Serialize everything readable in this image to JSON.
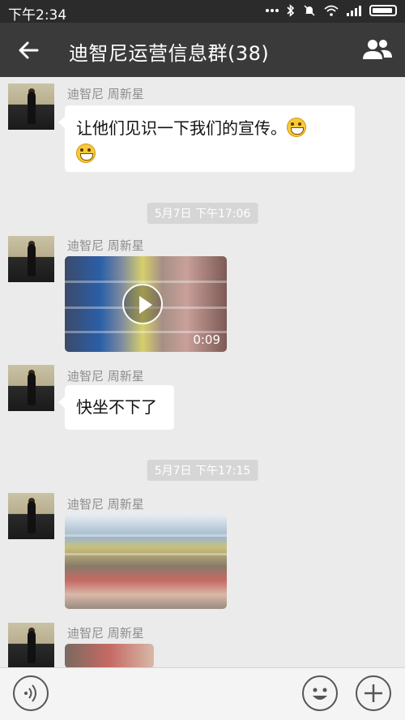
{
  "status_bar": {
    "time": "下午2:34"
  },
  "header": {
    "title": "迪智尼运营信息群(38)"
  },
  "messages": [
    {
      "sender": "迪智尼 周新星",
      "text": "让他们见识一下我们的宣传。"
    },
    {
      "timestamp": "5月7日 下午17:06"
    },
    {
      "sender": "迪智尼 周新星",
      "type": "video",
      "duration": "0:09"
    },
    {
      "sender": "迪智尼 周新星",
      "text": "快坐不下了"
    },
    {
      "timestamp": "5月7日 下午17:15"
    },
    {
      "sender": "迪智尼 周新星",
      "type": "photo"
    },
    {
      "sender": "迪智尼 周新星",
      "type": "photo"
    }
  ],
  "icons": {
    "back": "arrow-left-icon",
    "members": "group-icon",
    "voice": "voice-icon",
    "emoji": "smiley-icon",
    "more": "plus-icon"
  },
  "colors": {
    "header_bg": "#3a3a3a",
    "status_bg": "#2b2b2b",
    "chat_bg": "#ebebeb",
    "bubble_bg": "#ffffff"
  }
}
